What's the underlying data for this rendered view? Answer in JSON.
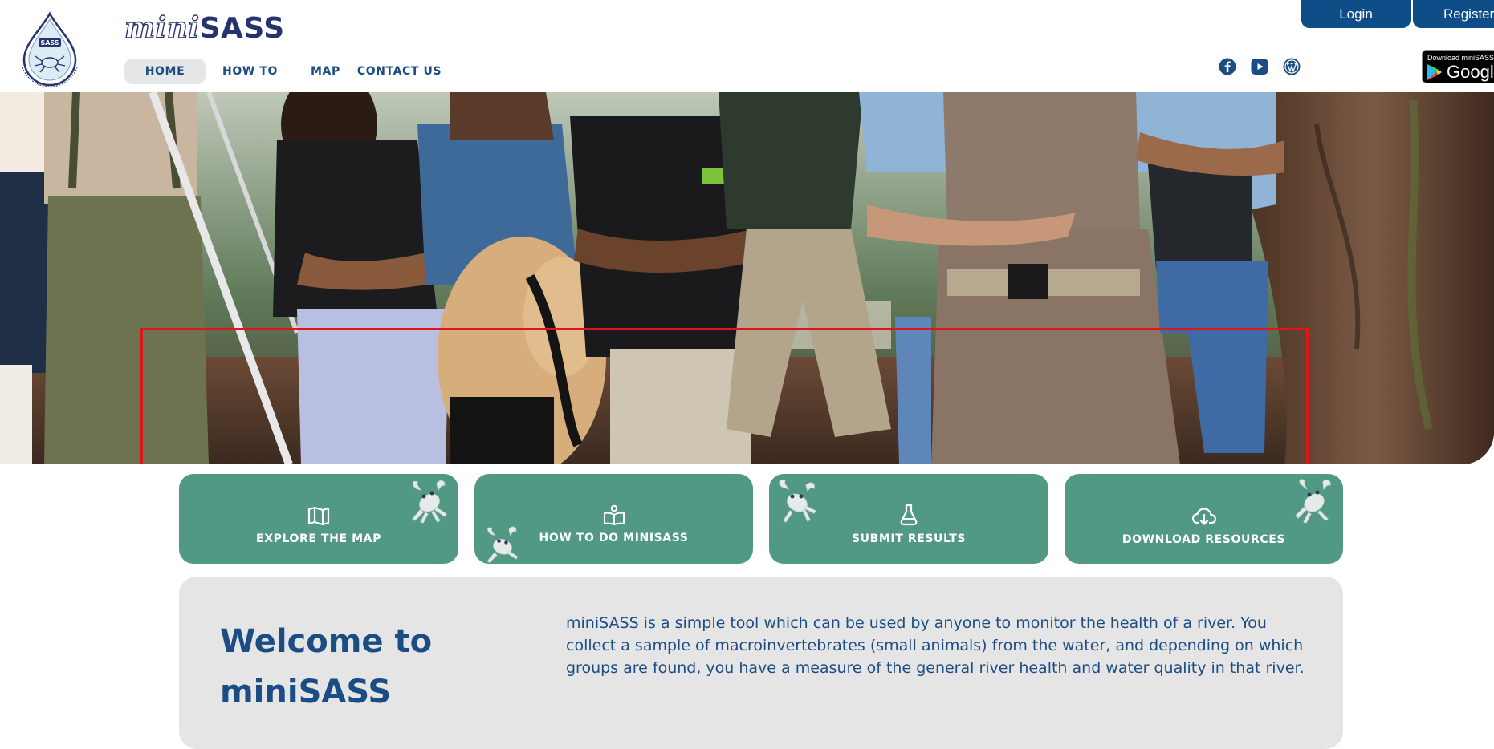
{
  "brand": {
    "mini": "mini",
    "sass": "SASS",
    "logo_icon": "minisass-water-drop-crab-logo"
  },
  "nav": {
    "items": [
      {
        "label": "HOME",
        "active": true
      },
      {
        "label": "HOW TO",
        "active": false
      },
      {
        "label": "MAP",
        "active": false
      },
      {
        "label": "CONTACT US",
        "active": false
      }
    ]
  },
  "social": {
    "icons": [
      "facebook-icon",
      "youtube-icon",
      "wordpress-icon"
    ]
  },
  "auth": {
    "login_label": "Login",
    "register_label": "Register"
  },
  "app_badge": {
    "small_text": "Download miniSASS",
    "big_text": "Google Play"
  },
  "hero": {
    "image": "group-of-people-standing-outdoors-near-river",
    "highlight_color": "#e0141b"
  },
  "cards": [
    {
      "label": "EXPLORE THE MAP",
      "icon": "open-map-icon"
    },
    {
      "label": "HOW TO DO MINISASS",
      "icon": "book-reader-icon"
    },
    {
      "label": "SUBMIT RESULTS",
      "icon": "flask-icon"
    },
    {
      "label": "DOWNLOAD RESOURCES",
      "icon": "cloud-download-icon"
    }
  ],
  "welcome": {
    "title": "Welcome to miniSASS",
    "body": "miniSASS is a simple tool which can be used by anyone to monitor the health of a river. You collect a sample of macroinvertebrates (small animals) from the water, and depending on which groups are found, you have a measure of the general river health and water quality in that river."
  },
  "colors": {
    "primary_blue": "#0f4d88",
    "text_blue": "#1b4d84",
    "card_green": "#519985",
    "panel_grey": "#e5e5e6"
  }
}
